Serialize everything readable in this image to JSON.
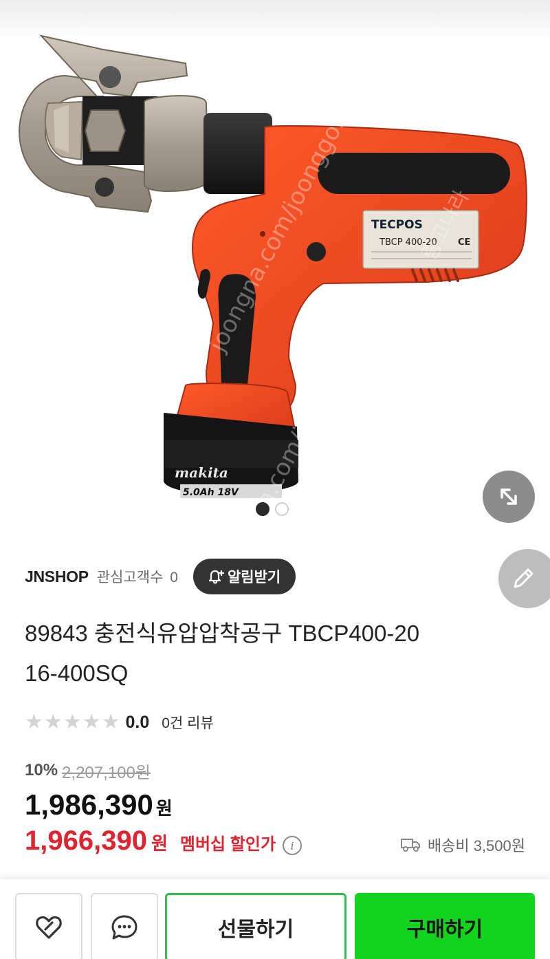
{
  "product_image": {
    "label_brand": "TECPOS",
    "label_model": "TBCP 400-20",
    "label_mark": "CE",
    "battery_brand": "makita",
    "battery_spec": "5.0Ah  18V",
    "watermark": "joongna.com/joonggonara",
    "watermark_side": "중고나라",
    "page_count": 2,
    "current_page": 1
  },
  "seller": {
    "name": "JNSHOP",
    "followers_label": "관심고객수",
    "followers_count": "0",
    "alarm_button": "알림받기"
  },
  "product": {
    "title_line1": "89843 충전식유압압착공구 TBCP400-20",
    "title_line2": "16-400SQ"
  },
  "rating": {
    "score": "0.0",
    "stars_filled": 0,
    "stars_total": 5,
    "review_text": "0건 리뷰"
  },
  "pricing": {
    "discount_rate": "10%",
    "original_price": "2,207,100원",
    "price": "1,986,390",
    "currency": "원",
    "member_price": "1,966,390",
    "member_currency": "원",
    "member_label": "멤버십 할인가",
    "shipping_text": "배송비 3,500원"
  },
  "bottom_bar": {
    "gift_button": "선물하기",
    "buy_button": "구매하기"
  },
  "colors": {
    "buy_green": "#11d41f",
    "gift_border": "#2fc24a",
    "member_red": "#e0242f",
    "tool_orange": "#f04a20"
  }
}
